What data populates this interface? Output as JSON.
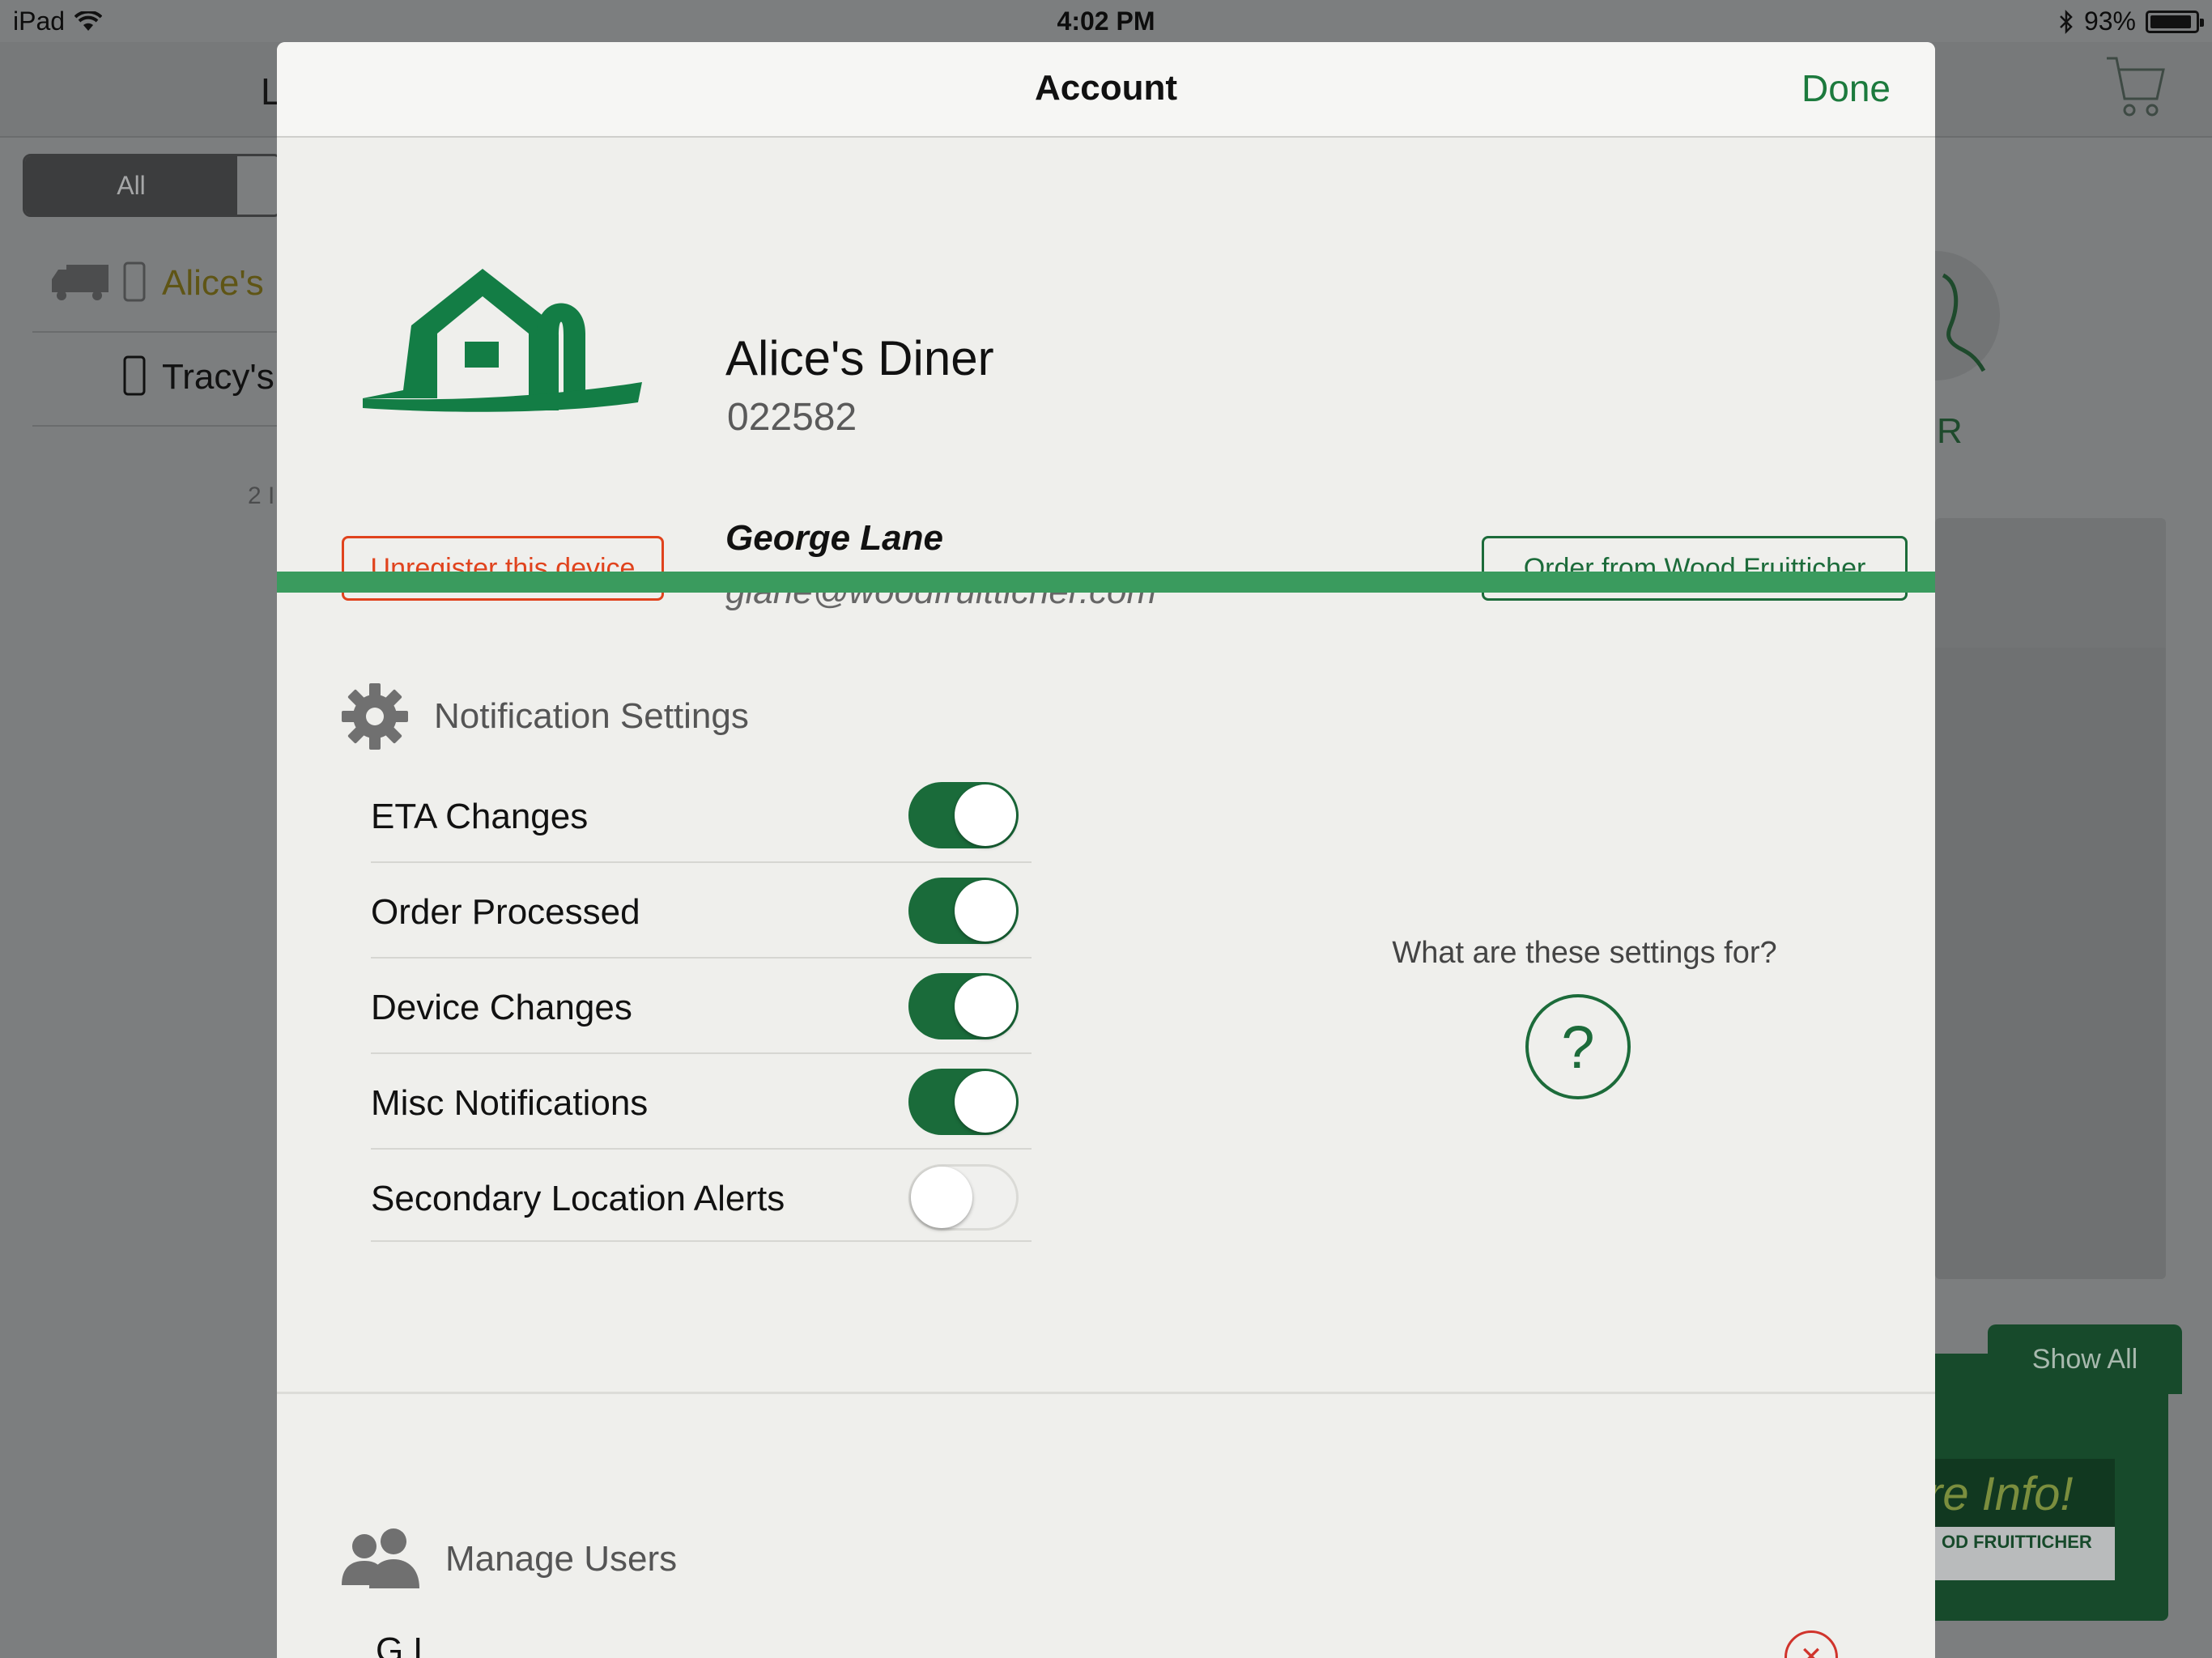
{
  "status_bar": {
    "device": "iPad",
    "time": "4:02 PM",
    "battery_percent": "93%",
    "battery_level": 0.93
  },
  "background": {
    "nav_letter": "L",
    "segment_all": "All",
    "list": [
      {
        "name": "Alice's"
      },
      {
        "name": "Tracy's"
      }
    ],
    "count_label": "2 I",
    "side_letter": "R",
    "show_all": "Show All",
    "promo_text": "re Info!",
    "promo_brand": "OD FRUITTICHER"
  },
  "modal": {
    "title": "Account",
    "done_label": "Done",
    "account": {
      "name": "Alice's Diner",
      "number": "022582"
    },
    "user": {
      "name": "George Lane",
      "email": "glane@woodfruitticher.com"
    },
    "unregister_label": "Unregister this device",
    "order_label": "Order from Wood Fruitticher",
    "notifications": {
      "title": "Notification Settings",
      "items": [
        {
          "label": "ETA Changes",
          "on": true
        },
        {
          "label": "Order Processed",
          "on": true
        },
        {
          "label": "Device Changes",
          "on": true
        },
        {
          "label": "Misc Notifications",
          "on": true
        },
        {
          "label": "Secondary Location Alerts",
          "on": false
        }
      ],
      "help_text": "What are these settings for?",
      "help_symbol": "?"
    },
    "manage_users": {
      "title": "Manage Users",
      "first_user_partial": "G L"
    }
  },
  "colors": {
    "brand_green": "#1c6b3a",
    "toggle_on": "#1a6b3a",
    "accent_bar": "#3a9b5e",
    "danger": "#e0431d"
  }
}
